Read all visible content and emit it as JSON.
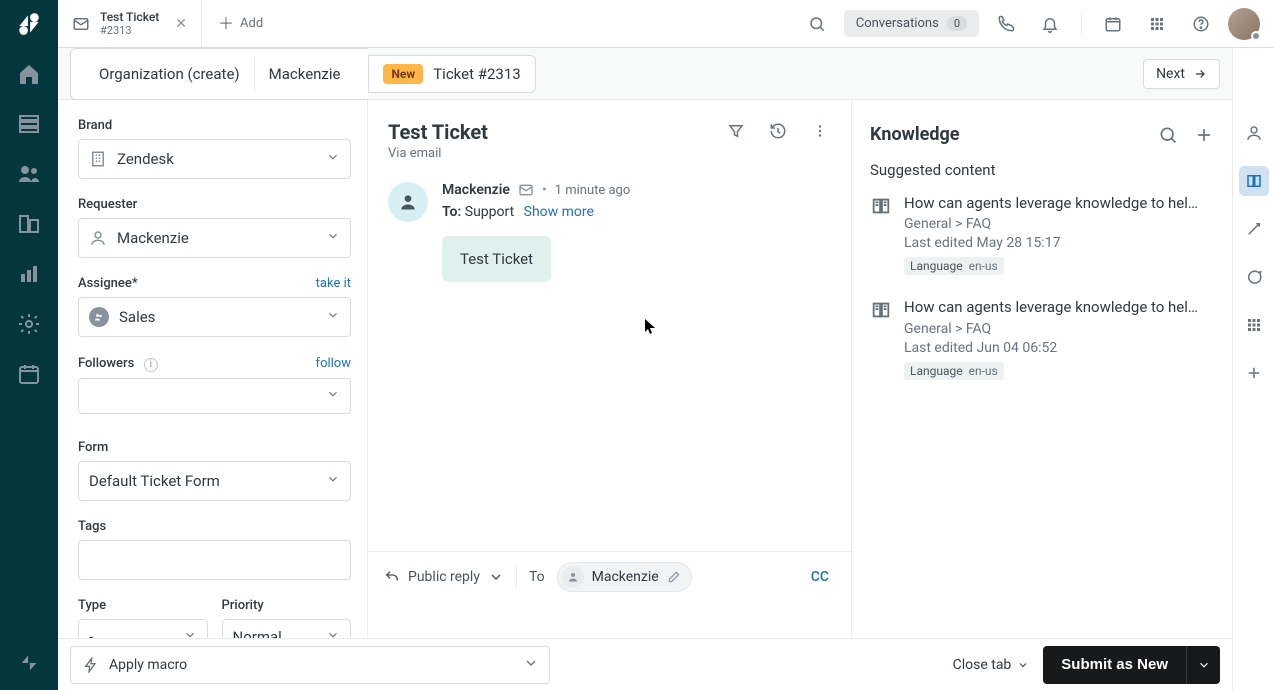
{
  "tabs": {
    "active": {
      "title": "Test Ticket",
      "sub": "#2313"
    },
    "add_label": "Add"
  },
  "topbar": {
    "conversations_label": "Conversations",
    "conversations_count": "0"
  },
  "context": {
    "org": "Organization (create)",
    "person": "Mackenzie",
    "status": "New",
    "ticket": "Ticket #2313",
    "next": "Next"
  },
  "sidebar": {
    "brand": {
      "label": "Brand",
      "value": "Zendesk"
    },
    "requester": {
      "label": "Requester",
      "value": "Mackenzie"
    },
    "assignee": {
      "label": "Assignee*",
      "value": "Sales",
      "action": "take it"
    },
    "followers": {
      "label": "Followers",
      "action": "follow"
    },
    "form": {
      "label": "Form",
      "value": "Default Ticket Form"
    },
    "tags": {
      "label": "Tags"
    },
    "type": {
      "label": "Type",
      "value": "-"
    },
    "priority": {
      "label": "Priority",
      "value": "Normal"
    }
  },
  "ticket": {
    "title": "Test Ticket",
    "via": "Via email",
    "message": {
      "author": "Mackenzie",
      "time": "1 minute ago",
      "to_label": "To:",
      "to_value": "Support",
      "show_more": "Show more",
      "body": "Test Ticket"
    }
  },
  "composer": {
    "reply_type": "Public reply",
    "to_label": "To",
    "to_chip": "Mackenzie",
    "cc": "CC"
  },
  "knowledge": {
    "title": "Knowledge",
    "subtitle": "Suggested content",
    "lang_label": "Language",
    "articles": [
      {
        "title": "How can agents leverage knowledge to help …",
        "path": "General > FAQ",
        "edited": "Last edited May 28 15:17",
        "lang": "en-us"
      },
      {
        "title": "How can agents leverage knowledge to help …",
        "path": "General > FAQ",
        "edited": "Last edited Jun 04 06:52",
        "lang": "en-us"
      }
    ]
  },
  "footer": {
    "macro": "Apply macro",
    "close_tab": "Close tab",
    "submit": "Submit as New"
  }
}
